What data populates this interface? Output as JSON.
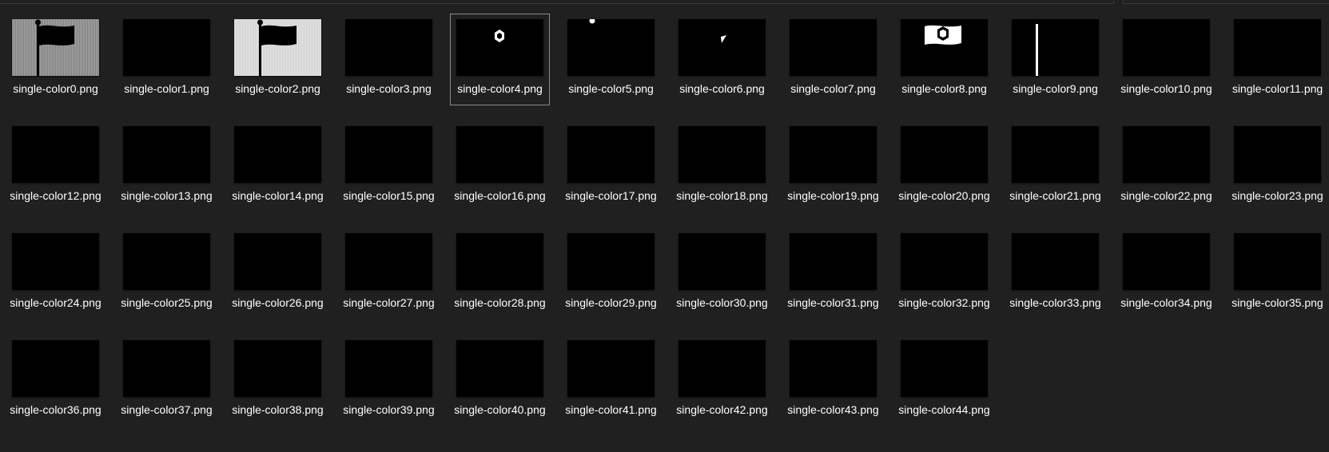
{
  "files": [
    {
      "name": "single-color0.png",
      "preview": "flag-gray-background",
      "selected": false
    },
    {
      "name": "single-color1.png",
      "preview": "black",
      "selected": false
    },
    {
      "name": "single-color2.png",
      "preview": "flag-light-background",
      "selected": false
    },
    {
      "name": "single-color3.png",
      "preview": "black",
      "selected": false
    },
    {
      "name": "single-color4.png",
      "preview": "small-logo",
      "selected": true
    },
    {
      "name": "single-color5.png",
      "preview": "dot",
      "selected": false
    },
    {
      "name": "single-color6.png",
      "preview": "small-corner",
      "selected": false
    },
    {
      "name": "single-color7.png",
      "preview": "black",
      "selected": false
    },
    {
      "name": "single-color8.png",
      "preview": "flag-logo",
      "selected": false
    },
    {
      "name": "single-color9.png",
      "preview": "pole",
      "selected": false
    },
    {
      "name": "single-color10.png",
      "preview": "black",
      "selected": false
    },
    {
      "name": "single-color11.png",
      "preview": "black",
      "selected": false
    },
    {
      "name": "single-color12.png",
      "preview": "black",
      "selected": false
    },
    {
      "name": "single-color13.png",
      "preview": "black",
      "selected": false
    },
    {
      "name": "single-color14.png",
      "preview": "black",
      "selected": false
    },
    {
      "name": "single-color15.png",
      "preview": "black",
      "selected": false
    },
    {
      "name": "single-color16.png",
      "preview": "black",
      "selected": false
    },
    {
      "name": "single-color17.png",
      "preview": "black",
      "selected": false
    },
    {
      "name": "single-color18.png",
      "preview": "black",
      "selected": false
    },
    {
      "name": "single-color19.png",
      "preview": "black",
      "selected": false
    },
    {
      "name": "single-color20.png",
      "preview": "black",
      "selected": false
    },
    {
      "name": "single-color21.png",
      "preview": "black",
      "selected": false
    },
    {
      "name": "single-color22.png",
      "preview": "black",
      "selected": false
    },
    {
      "name": "single-color23.png",
      "preview": "black",
      "selected": false
    },
    {
      "name": "single-color24.png",
      "preview": "black",
      "selected": false
    },
    {
      "name": "single-color25.png",
      "preview": "black",
      "selected": false
    },
    {
      "name": "single-color26.png",
      "preview": "black",
      "selected": false
    },
    {
      "name": "single-color27.png",
      "preview": "black",
      "selected": false
    },
    {
      "name": "single-color28.png",
      "preview": "black",
      "selected": false
    },
    {
      "name": "single-color29.png",
      "preview": "black",
      "selected": false
    },
    {
      "name": "single-color30.png",
      "preview": "black",
      "selected": false
    },
    {
      "name": "single-color31.png",
      "preview": "black",
      "selected": false
    },
    {
      "name": "single-color32.png",
      "preview": "black",
      "selected": false
    },
    {
      "name": "single-color33.png",
      "preview": "black",
      "selected": false
    },
    {
      "name": "single-color34.png",
      "preview": "black",
      "selected": false
    },
    {
      "name": "single-color35.png",
      "preview": "black",
      "selected": false
    },
    {
      "name": "single-color36.png",
      "preview": "black",
      "selected": false
    },
    {
      "name": "single-color37.png",
      "preview": "black",
      "selected": false
    },
    {
      "name": "single-color38.png",
      "preview": "black",
      "selected": false
    },
    {
      "name": "single-color39.png",
      "preview": "black",
      "selected": false
    },
    {
      "name": "single-color40.png",
      "preview": "black",
      "selected": false
    },
    {
      "name": "single-color41.png",
      "preview": "black",
      "selected": false
    },
    {
      "name": "single-color42.png",
      "preview": "black",
      "selected": false
    },
    {
      "name": "single-color43.png",
      "preview": "black",
      "selected": false
    },
    {
      "name": "single-color44.png",
      "preview": "black",
      "selected": false
    }
  ],
  "colors": {
    "background": "#202020",
    "selected_border": "#8a8a8a",
    "text": "#ffffff"
  }
}
